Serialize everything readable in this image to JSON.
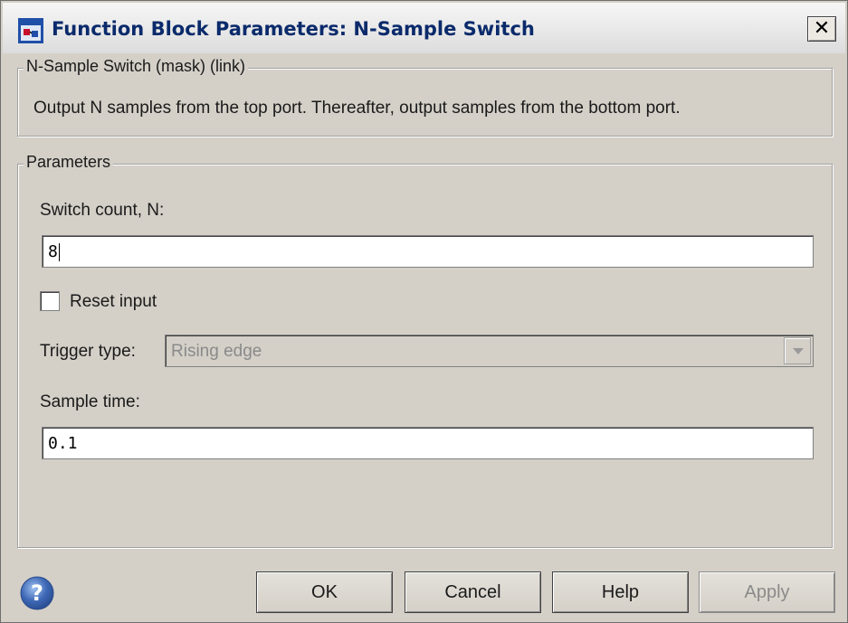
{
  "window": {
    "title": "Function Block Parameters: N-Sample Switch",
    "close_label": "✕",
    "icon": "simulink-block-icon"
  },
  "description_group": {
    "legend": "N-Sample Switch (mask) (link)",
    "text": "Output N samples from the top port.  Thereafter, output samples from the bottom port."
  },
  "parameters_group": {
    "legend": "Parameters",
    "switch_count": {
      "label": "Switch count, N:",
      "value": "8"
    },
    "reset_input": {
      "label": "Reset input",
      "checked": false
    },
    "trigger_type": {
      "label": "Trigger type:",
      "value": "Rising edge",
      "enabled": false
    },
    "sample_time": {
      "label": "Sample time:",
      "value": "0.1"
    }
  },
  "buttons": {
    "ok": "OK",
    "cancel": "Cancel",
    "help": "Help",
    "apply": "Apply",
    "apply_enabled": false
  },
  "colors": {
    "dialog_bg": "#d4d0c8",
    "title_text": "#0a2a6b",
    "help_icon": "#3f69b6",
    "disabled_text": "#8a8a8a"
  }
}
